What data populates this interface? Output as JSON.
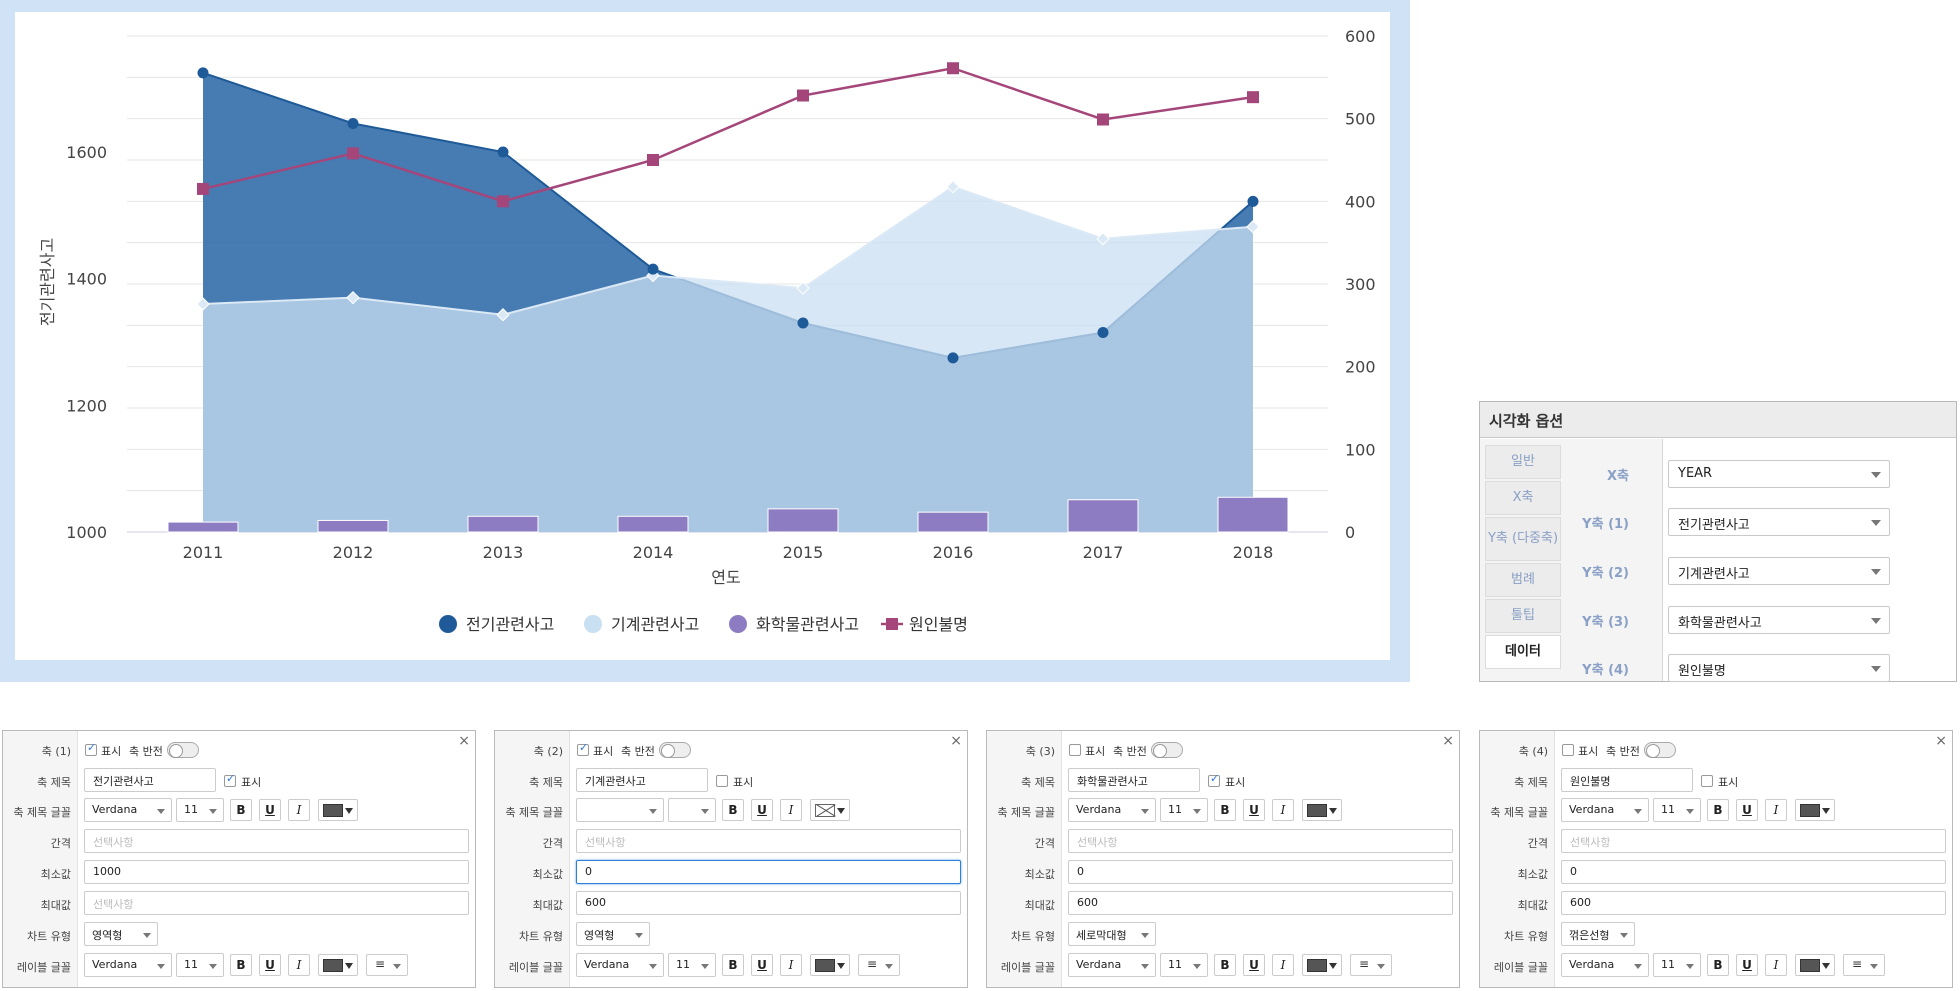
{
  "chart_data": {
    "type": "area",
    "xlabel": "연도",
    "ylabel_left": "전기관련사고",
    "categories": [
      "2011",
      "2012",
      "2013",
      "2014",
      "2015",
      "2016",
      "2017",
      "2018"
    ],
    "y_left": {
      "min": 1000,
      "max": 1750,
      "ticks": [
        1000,
        1200,
        1400,
        1600
      ]
    },
    "y_right": {
      "min": 0,
      "max": 600,
      "ticks": [
        0,
        100,
        200,
        300,
        400,
        500,
        600
      ]
    },
    "series": [
      {
        "name": "기계관련사고",
        "type": "area",
        "axis": "left",
        "color": "#c9dff2",
        "values": [
          1360,
          1370,
          1343,
          1405,
          1385,
          1545,
          1463,
          1482
        ]
      },
      {
        "name": "전기관련사고",
        "type": "area",
        "axis": "left",
        "color": "#2e6aa8",
        "values": [
          1725,
          1645,
          1600,
          1415,
          1330,
          1275,
          1315,
          1522
        ]
      },
      {
        "name": "화학물관련사고",
        "type": "bar",
        "axis": "right",
        "color": "#8e7cc3",
        "values": [
          12,
          14,
          19,
          19,
          28,
          24,
          39,
          42
        ]
      },
      {
        "name": "원인불명",
        "type": "line",
        "axis": "right",
        "color": "#a5467a",
        "values": [
          415,
          458,
          400,
          450,
          528,
          561,
          499,
          526
        ]
      }
    ],
    "legend": "bottom",
    "grid": true
  },
  "viz_panel": {
    "title": "시각화 옵션",
    "tabs": [
      "일반",
      "X축",
      "Y축 (다중축)",
      "범례",
      "툴팁",
      "데이터"
    ],
    "active_tab": "데이터",
    "rows": [
      {
        "label": "X축",
        "value": "YEAR"
      },
      {
        "label": "Y축 (1)",
        "value": "전기관련사고"
      },
      {
        "label": "Y축 (2)",
        "value": "기계관련사고"
      },
      {
        "label": "Y축 (3)",
        "value": "화학물관련사고"
      },
      {
        "label": "Y축 (4)",
        "value": "원인불명"
      }
    ]
  },
  "axis_labels": {
    "show": "표시",
    "invert": "축 반전",
    "title": "축 제목",
    "title_font": "축 제목 글꼴",
    "interval": "간격",
    "min": "최소값",
    "max": "최대값",
    "chart_type": "차트 유형",
    "label_font": "레이블 글꼴",
    "placeholder": "선택사항",
    "close": "×",
    "bold": "B",
    "underline": "U",
    "italic": "I",
    "align": "≡"
  },
  "axis_cards": [
    {
      "name": "축 (1)",
      "show": true,
      "title": "전기관련사고",
      "title_show": true,
      "font": "Verdana",
      "size": "11",
      "min": "1000",
      "max": "",
      "chart_type": "영역형",
      "label_font": "Verdana",
      "label_size": "11"
    },
    {
      "name": "축 (2)",
      "show": true,
      "title": "기계관련사고",
      "title_show": false,
      "font": "",
      "size": "",
      "min": "0",
      "max": "600",
      "chart_type": "영역형",
      "label_font": "Verdana",
      "label_size": "11"
    },
    {
      "name": "축 (3)",
      "show": false,
      "title": "화학물관련사고",
      "title_show": true,
      "font": "Verdana",
      "size": "11",
      "min": "0",
      "max": "600",
      "chart_type": "세로막대형",
      "label_font": "Verdana",
      "label_size": "11"
    },
    {
      "name": "축 (4)",
      "show": false,
      "title": "원인불명",
      "title_show": false,
      "font": "Verdana",
      "size": "11",
      "min": "0",
      "max": "600",
      "chart_type": "꺾은선형",
      "label_font": "Verdana",
      "label_size": "11"
    }
  ]
}
